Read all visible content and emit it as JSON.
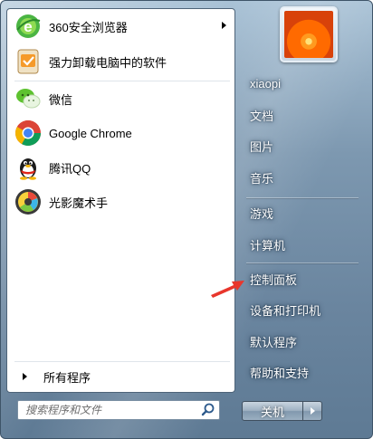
{
  "pinned_programs": [
    {
      "label": "360安全浏览器",
      "icon": "360-browser-icon",
      "has_submenu": true
    },
    {
      "label": "强力卸载电脑中的软件",
      "icon": "uninstall-icon",
      "has_submenu": false
    }
  ],
  "recent_programs": [
    {
      "label": "微信",
      "icon": "wechat-icon"
    },
    {
      "label": "Google Chrome",
      "icon": "chrome-icon"
    },
    {
      "label": "腾讯QQ",
      "icon": "qq-penguin-icon"
    },
    {
      "label": "光影魔术手",
      "icon": "neoimaging-icon"
    }
  ],
  "all_programs_label": "所有程序",
  "search": {
    "placeholder": "搜索程序和文件"
  },
  "user": {
    "name": "xiaopi"
  },
  "right_links": [
    {
      "label": "文档"
    },
    {
      "label": "图片"
    },
    {
      "label": "音乐"
    },
    {
      "label": "游戏"
    },
    {
      "label": "计算机"
    },
    {
      "label": "控制面板"
    },
    {
      "label": "设备和打印机"
    },
    {
      "label": "默认程序"
    },
    {
      "label": "帮助和支持"
    }
  ],
  "shutdown_label": "关机",
  "colors": {
    "annotation_arrow": "#e8362c",
    "panel_glass": "#6a859f"
  }
}
